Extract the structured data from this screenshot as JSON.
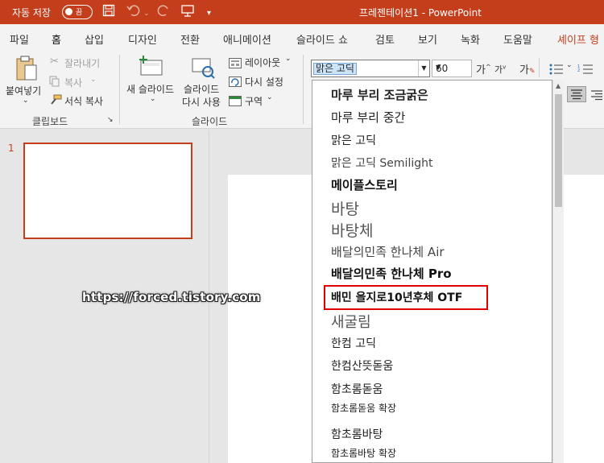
{
  "titlebar": {
    "autosave_label": "자동 저장",
    "toggle_state": "끔",
    "document_title": "프레젠테이션1  -  PowerPoint"
  },
  "menu": {
    "tabs": [
      {
        "label": "파일"
      },
      {
        "label": "홈"
      },
      {
        "label": "삽입"
      },
      {
        "label": "디자인"
      },
      {
        "label": "전환"
      },
      {
        "label": "애니메이션"
      },
      {
        "label": "슬라이드 쇼"
      },
      {
        "label": "검토"
      },
      {
        "label": "보기"
      },
      {
        "label": "녹화"
      },
      {
        "label": "도움말"
      },
      {
        "label": "셰이프 형식"
      }
    ]
  },
  "ribbon": {
    "clipboard": {
      "paste": "붙여넣기",
      "cut": "잘라내기",
      "copy": "복사",
      "format_painter": "서식 복사",
      "group": "클립보드"
    },
    "slides": {
      "new_slide": "새 슬라이드",
      "reuse_line1": "슬라이드",
      "reuse_line2": "다시 사용",
      "layout": "레이아웃",
      "reset": "다시 설정",
      "section": "구역",
      "group": "슬라이드"
    },
    "font": {
      "current_font": "맑은 고딕",
      "current_size": "60"
    }
  },
  "slides_pane": {
    "slide_number": "1"
  },
  "font_list": [
    {
      "name": "마루 부리 조금굵은"
    },
    {
      "name": "마루 부리 중간"
    },
    {
      "name": "맑은 고딕"
    },
    {
      "name": "맑은 고딕 Semilight"
    },
    {
      "name": "메이플스토리"
    },
    {
      "name": "바탕"
    },
    {
      "name": "바탕체"
    },
    {
      "name": "배달의민족 한나체 Air"
    },
    {
      "name": "배달의민족 한나체 Pro"
    },
    {
      "name": "배민 을지로10년후체 OTF"
    },
    {
      "name": "새굴림"
    },
    {
      "name": "한컴 고딕"
    },
    {
      "name": "한컴산뜻돋움"
    },
    {
      "name": "함초롬돋움"
    },
    {
      "name": "함초롬돋움 확장"
    },
    {
      "name": "함초롬바탕"
    },
    {
      "name": "함초롬바탕 확장"
    }
  ],
  "watermark": "https://forced.tistory.com",
  "colors": {
    "accent": "#c43e1c",
    "highlight_box": "#e00000"
  }
}
